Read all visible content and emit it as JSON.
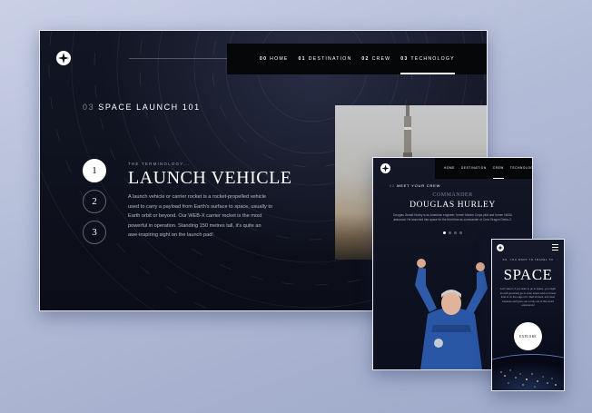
{
  "desktop": {
    "nav": [
      {
        "num": "00",
        "label": "HOME"
      },
      {
        "num": "01",
        "label": "DESTINATION"
      },
      {
        "num": "02",
        "label": "CREW"
      },
      {
        "num": "03",
        "label": "TECHNOLOGY"
      }
    ],
    "active_nav": "TECHNOLOGY",
    "heading_num": "03",
    "heading": "SPACE LAUNCH 101",
    "steps": [
      "1",
      "2",
      "3"
    ],
    "active_step": "1",
    "terminology": "THE TERMINOLOGY...",
    "title": "LAUNCH VEHICLE",
    "body": "A launch vehicle or carrier rocket is a rocket-propelled vehicle used to carry a payload from Earth's surface to space, usually to Earth orbit or beyond. Our WEB-X carrier rocket is the most powerful in operation. Standing 150 metres tall, it's quite an awe-inspiring sight on the launch pad!"
  },
  "tablet": {
    "nav": [
      "HOME",
      "DESTINATION",
      "CREW",
      "TECHNOLOGY"
    ],
    "active_nav": "CREW",
    "heading_num": "02",
    "heading": "MEET YOUR CREW",
    "role": "COMMANDER",
    "name": "DOUGLAS HURLEY",
    "bio": "Douglas Gerald Hurley is an American engineer, former Marine Corps pilot and former NASA astronaut. He launched into space for the third time as commander of Crew Dragon Demo-2."
  },
  "mobile": {
    "eyebrow": "SO, YOU WANT TO TRAVEL TO",
    "title": "SPACE",
    "body": "Let's face it; if you want to go to space, you might as well genuinely go to outer space and not hover kind of on the edge of it. Well sit back, and relax because we'll give you a truly out of this world experience!",
    "explore": "EXPLORE"
  },
  "colors": {
    "dark": "#0b0d18",
    "accent": "#ffffff",
    "muted": "#7a7f95"
  },
  "icons": {
    "logo": "star-logo-icon",
    "menu": "hamburger-menu-icon"
  }
}
